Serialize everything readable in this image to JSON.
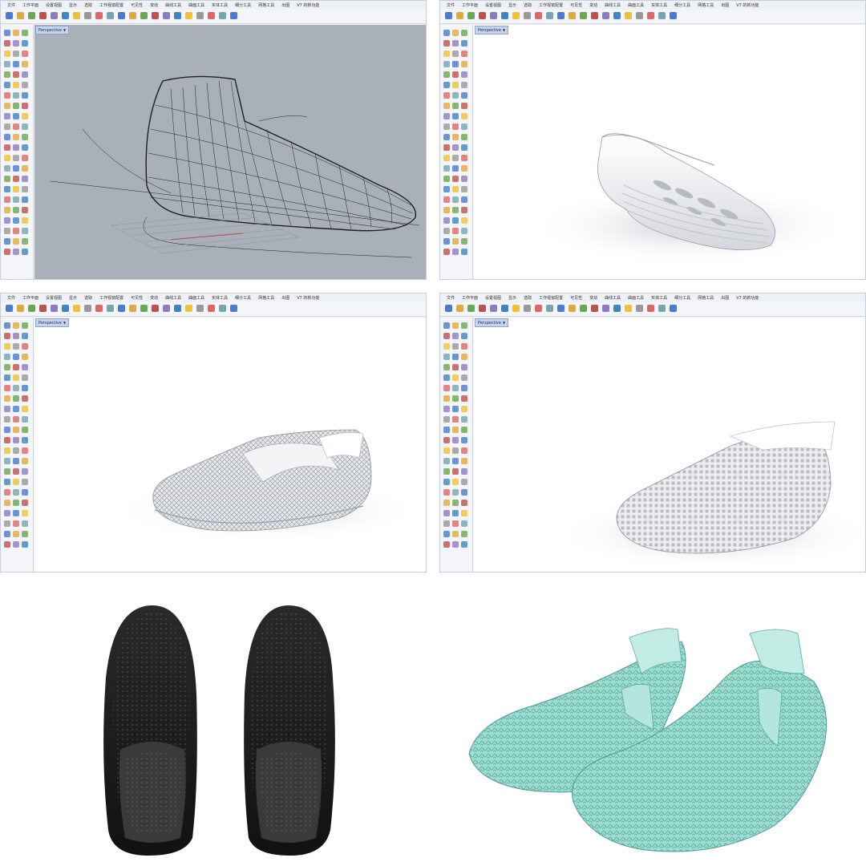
{
  "menu": [
    "文件",
    "工作平面",
    "设置视图",
    "显示",
    "选取",
    "工作视窗配置",
    "可见性",
    "变动",
    "曲线工具",
    "曲面工具",
    "实体工具",
    "细分工具",
    "网格工具",
    "出图",
    "V7 的新功能"
  ],
  "viewport_label": "Perspective",
  "colors": {
    "wire_bg": "#aab0ba",
    "label_bg": "#c7d3ec",
    "shoe_teal": "#8ad3c6",
    "shoe_black": "#1e1e1e"
  },
  "icons": [
    "new-file-icon",
    "open-file-icon",
    "save-icon",
    "print-icon",
    "cut-icon",
    "copy-icon",
    "paste-icon",
    "undo-icon",
    "pan-icon",
    "rotate-icon",
    "zoom-icon",
    "zoom-window-icon",
    "zoom-extents-icon",
    "select-icon",
    "grid-icon",
    "layer-icon",
    "light-icon",
    "material-icon",
    "render-sphere-icon",
    "render-preview-icon",
    "help-icon"
  ]
}
